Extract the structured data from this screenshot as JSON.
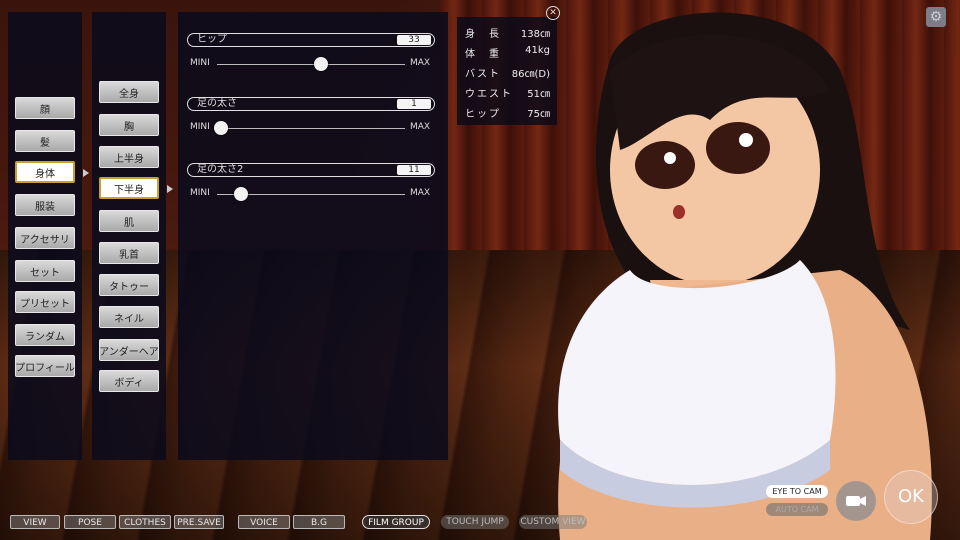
{
  "menu_main": [
    {
      "label": "顔",
      "selected": false
    },
    {
      "label": "髪",
      "selected": false
    },
    {
      "label": "身体",
      "selected": true
    },
    {
      "label": "服装",
      "selected": false
    },
    {
      "label": "アクセサリ",
      "selected": false
    },
    {
      "label": "セット",
      "selected": false
    },
    {
      "label": "プリセット",
      "selected": false
    },
    {
      "label": "ランダム",
      "selected": false
    },
    {
      "label": "プロフィール",
      "selected": false
    }
  ],
  "menu_body": [
    {
      "label": "全身",
      "selected": false
    },
    {
      "label": "胸",
      "selected": false
    },
    {
      "label": "上半身",
      "selected": false
    },
    {
      "label": "下半身",
      "selected": true
    },
    {
      "label": "肌",
      "selected": false
    },
    {
      "label": "乳首",
      "selected": false
    },
    {
      "label": "タトゥー",
      "selected": false
    },
    {
      "label": "ネイル",
      "selected": false
    },
    {
      "label": "アンダーヘア",
      "selected": false
    },
    {
      "label": "ボディ",
      "selected": false
    }
  ],
  "sliders": [
    {
      "label": "ヒップ",
      "value": "33",
      "level": 0.54,
      "min_label": "MINI",
      "max_label": "MAX"
    },
    {
      "label": "足の太さ",
      "value": "1",
      "level": 0.0,
      "min_label": "MINI",
      "max_label": "MAX"
    },
    {
      "label": "足の太さ2",
      "value": "11",
      "level": 0.11,
      "min_label": "MINI",
      "max_label": "MAX"
    }
  ],
  "stats": [
    {
      "key": "身　長",
      "value": "138㎝"
    },
    {
      "key": "体　重",
      "value": "41kg"
    },
    {
      "key": "バスト",
      "value": "86㎝(D)"
    },
    {
      "key": "ウエスト",
      "value": "51㎝"
    },
    {
      "key": "ヒップ",
      "value": "75㎝"
    }
  ],
  "bottom_bar": [
    "VIEW",
    "POSE",
    "CLOTHES",
    "PRE.SAVE",
    "VOICE",
    "B.G",
    "FILM GROUP",
    "TOUCH JUMP",
    "CUSTOM VIEW"
  ],
  "camera": {
    "eye_to_cam": "EYE TO CAM",
    "auto_cam": "AUTO CAM"
  },
  "ok_label": "OK",
  "icons": {
    "close": "close-circle-icon",
    "settings": "gear-icon",
    "camera": "video-camera-icon"
  }
}
